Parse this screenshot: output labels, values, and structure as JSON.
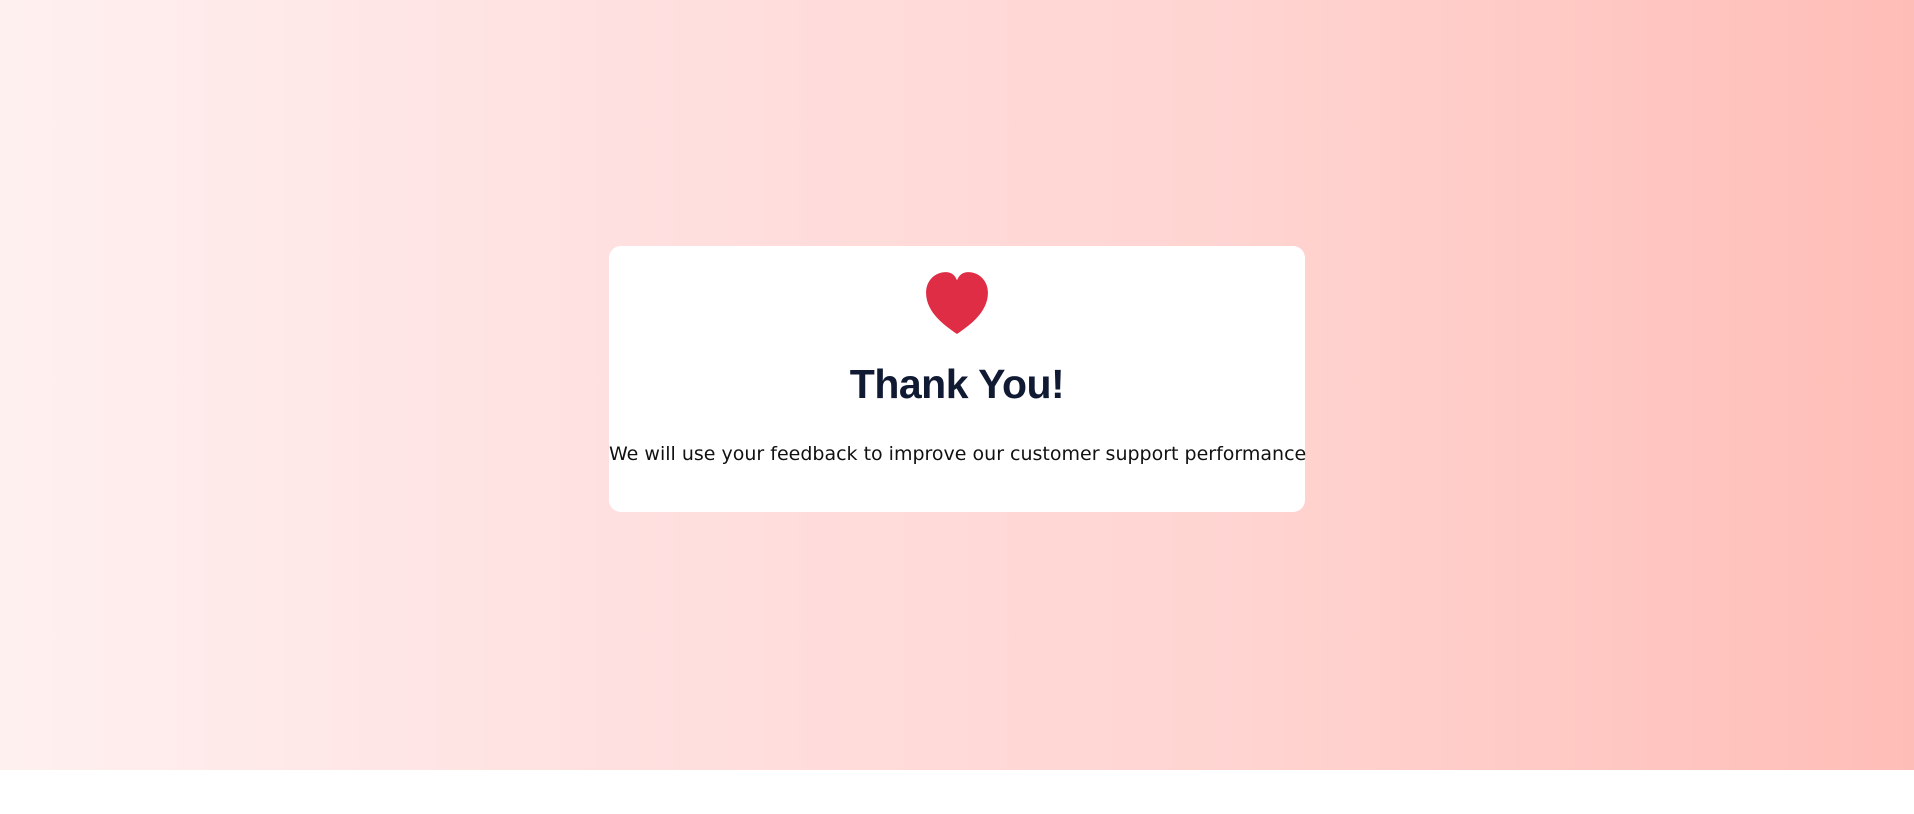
{
  "page": {
    "background_colors": [
      "#fff0f0",
      "#ffe1e1",
      "#ffd4d1",
      "#ffbdb7"
    ]
  },
  "card": {
    "icon": "heart-icon",
    "icon_color": "#de2d45",
    "title": "Thank You!",
    "message": "We will use your feedback to improve our customer support performance"
  }
}
